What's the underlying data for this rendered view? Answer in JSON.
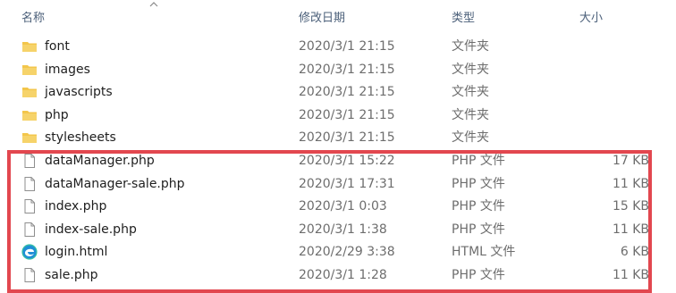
{
  "columns": {
    "name": "名称",
    "modified": "修改日期",
    "type": "类型",
    "size": "大小"
  },
  "colors": {
    "highlight": "#e2474f",
    "folder": "#f3c64b",
    "header_text": "#4c607a"
  },
  "files": [
    {
      "name": "font",
      "modified": "2020/3/1 21:15",
      "type": "文件夹",
      "size": "",
      "icon": "folder-icon"
    },
    {
      "name": "images",
      "modified": "2020/3/1 21:15",
      "type": "文件夹",
      "size": "",
      "icon": "folder-icon"
    },
    {
      "name": "javascripts",
      "modified": "2020/3/1 21:15",
      "type": "文件夹",
      "size": "",
      "icon": "folder-icon"
    },
    {
      "name": "php",
      "modified": "2020/3/1 21:15",
      "type": "文件夹",
      "size": "",
      "icon": "folder-icon"
    },
    {
      "name": "stylesheets",
      "modified": "2020/3/1 21:15",
      "type": "文件夹",
      "size": "",
      "icon": "folder-icon"
    },
    {
      "name": "dataManager.php",
      "modified": "2020/3/1 15:22",
      "type": "PHP 文件",
      "size": "17 KB",
      "icon": "file-icon"
    },
    {
      "name": "dataManager-sale.php",
      "modified": "2020/3/1 17:31",
      "type": "PHP 文件",
      "size": "11 KB",
      "icon": "file-icon"
    },
    {
      "name": "index.php",
      "modified": "2020/3/1 0:03",
      "type": "PHP 文件",
      "size": "15 KB",
      "icon": "file-icon"
    },
    {
      "name": "index-sale.php",
      "modified": "2020/3/1 1:38",
      "type": "PHP 文件",
      "size": "11 KB",
      "icon": "file-icon"
    },
    {
      "name": "login.html",
      "modified": "2020/2/29 3:38",
      "type": "HTML 文件",
      "size": "6 KB",
      "icon": "edge-browser-icon"
    },
    {
      "name": "sale.php",
      "modified": "2020/3/1 1:28",
      "type": "PHP 文件",
      "size": "11 KB",
      "icon": "file-icon"
    }
  ]
}
